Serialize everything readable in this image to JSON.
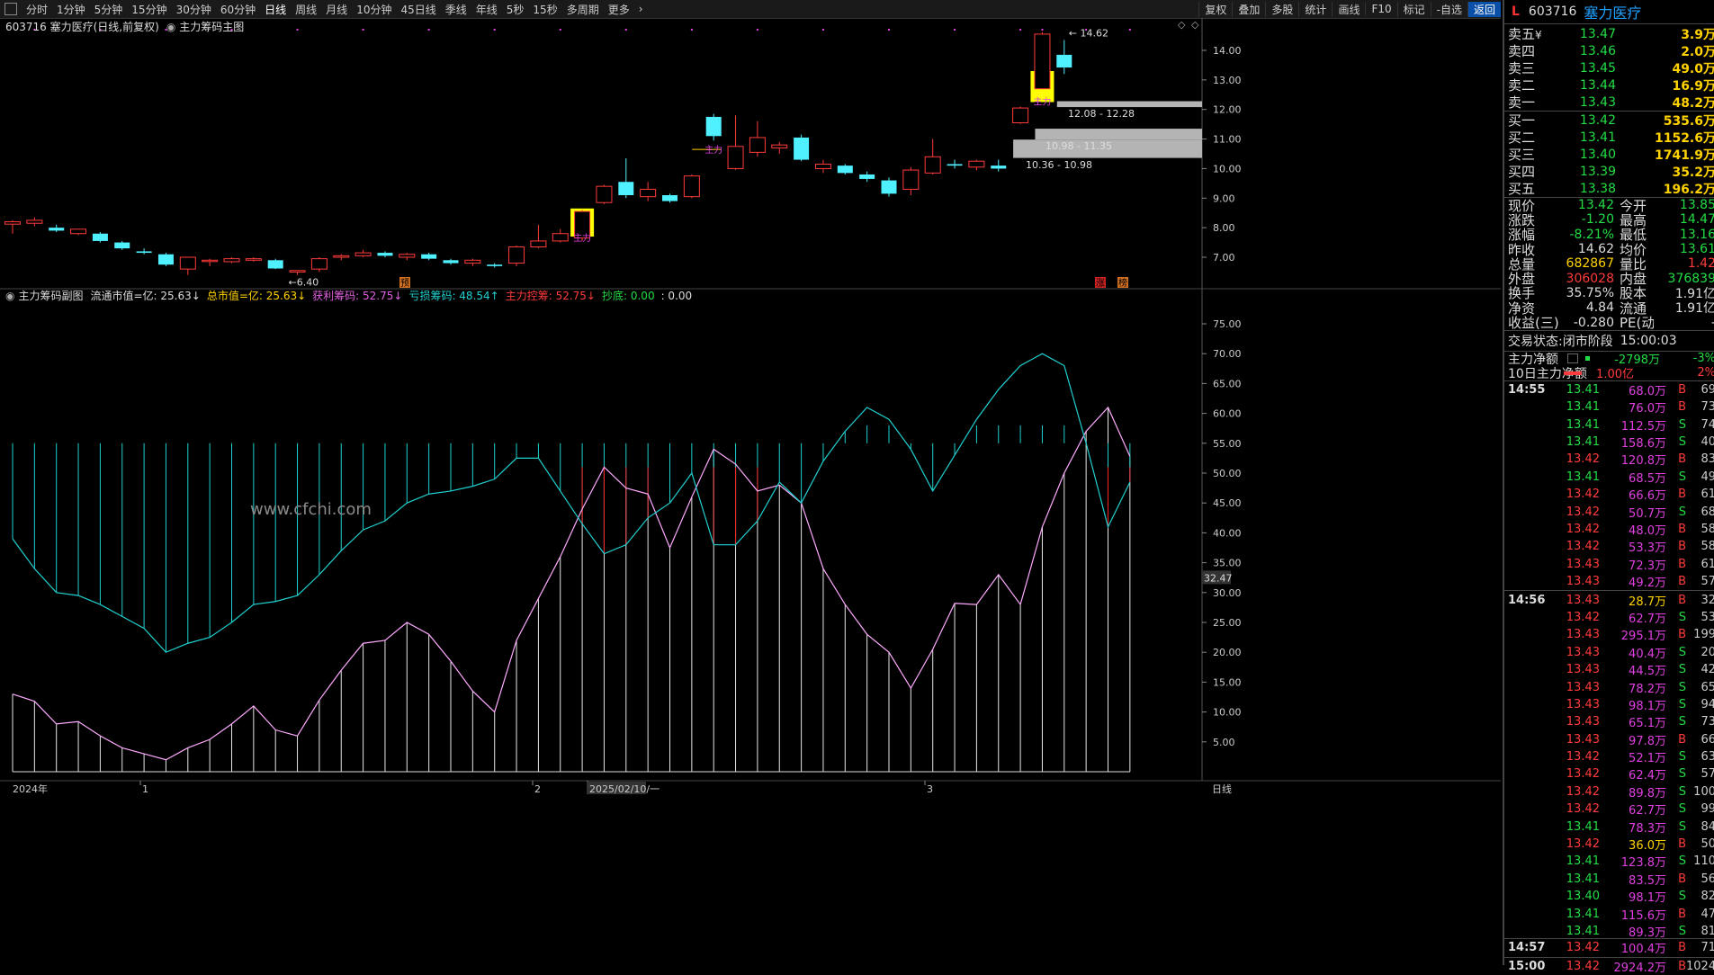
{
  "toolbar": {
    "periods": [
      "分时",
      "1分钟",
      "5分钟",
      "15分钟",
      "30分钟",
      "60分钟",
      "日线",
      "周线",
      "月线",
      "10分钟",
      "45日线",
      "季线",
      "年线",
      "5秒",
      "15秒",
      "多周期",
      "更多"
    ],
    "active_period": "日线",
    "actions": [
      "复权",
      "叠加",
      "多股",
      "统计",
      "画线",
      "F10",
      "标记",
      "-自选",
      "返回"
    ],
    "active_action": "返回"
  },
  "main_chart": {
    "header": "603716 塞力医疗(日线,前复权)",
    "indicator_name": "主力筹码主图",
    "y_ticks": [
      14.0,
      13.0,
      12.0,
      11.0,
      10.0,
      9.0,
      8.0,
      7.0
    ],
    "y_range": [
      6.0,
      15.0
    ],
    "high_label": "14.62",
    "low_label": "6.40",
    "zone_labels": [
      "12.08 - 12.28",
      "10.98 - 11.35",
      "10.36 - 10.98"
    ],
    "zones": [
      {
        "lo": 12.08,
        "hi": 12.28,
        "from": 48
      },
      {
        "lo": 10.98,
        "hi": 11.35,
        "from": 47
      },
      {
        "lo": 10.36,
        "hi": 10.98,
        "from": 46
      }
    ],
    "markers": {
      "main": "主力",
      "pre": "预",
      "rise": "涨",
      "hot": "榜"
    },
    "candles": [
      {
        "o": 8.12,
        "h": 8.25,
        "l": 7.8,
        "c": 8.2
      },
      {
        "o": 8.15,
        "h": 8.35,
        "l": 8.05,
        "c": 8.25
      },
      {
        "o": 8.0,
        "h": 8.1,
        "l": 7.85,
        "c": 7.9
      },
      {
        "o": 7.8,
        "h": 7.95,
        "l": 7.75,
        "c": 7.95
      },
      {
        "o": 7.8,
        "h": 7.85,
        "l": 7.5,
        "c": 7.55
      },
      {
        "o": 7.5,
        "h": 7.55,
        "l": 7.25,
        "c": 7.3
      },
      {
        "o": 7.2,
        "h": 7.3,
        "l": 7.1,
        "c": 7.15
      },
      {
        "o": 7.1,
        "h": 7.15,
        "l": 6.7,
        "c": 6.75
      },
      {
        "o": 6.6,
        "h": 7.0,
        "l": 6.4,
        "c": 7.0
      },
      {
        "o": 6.9,
        "h": 6.95,
        "l": 6.7,
        "c": 6.9
      },
      {
        "o": 6.85,
        "h": 7.0,
        "l": 6.8,
        "c": 6.95
      },
      {
        "o": 6.9,
        "h": 7.0,
        "l": 6.85,
        "c": 6.95
      },
      {
        "o": 6.9,
        "h": 6.95,
        "l": 6.6,
        "c": 6.62
      },
      {
        "o": 6.5,
        "h": 6.55,
        "l": 6.4,
        "c": 6.55
      },
      {
        "o": 6.6,
        "h": 7.0,
        "l": 6.5,
        "c": 6.95
      },
      {
        "o": 7.0,
        "h": 7.1,
        "l": 6.9,
        "c": 7.05
      },
      {
        "o": 7.05,
        "h": 7.25,
        "l": 7.0,
        "c": 7.15
      },
      {
        "o": 7.15,
        "h": 7.2,
        "l": 7.0,
        "c": 7.05
      },
      {
        "o": 7.0,
        "h": 7.15,
        "l": 6.9,
        "c": 7.1
      },
      {
        "o": 7.1,
        "h": 7.15,
        "l": 6.9,
        "c": 6.95
      },
      {
        "o": 6.9,
        "h": 6.95,
        "l": 6.75,
        "c": 6.8
      },
      {
        "o": 6.8,
        "h": 6.95,
        "l": 6.7,
        "c": 6.9
      },
      {
        "o": 6.75,
        "h": 6.8,
        "l": 6.65,
        "c": 6.7
      },
      {
        "o": 6.8,
        "h": 7.4,
        "l": 6.7,
        "c": 7.35
      },
      {
        "o": 7.35,
        "h": 8.1,
        "l": 7.3,
        "c": 7.55
      },
      {
        "o": 7.55,
        "h": 7.95,
        "l": 7.5,
        "c": 7.8
      },
      {
        "o": 7.65,
        "h": 8.6,
        "l": 7.55,
        "c": 8.55
      },
      {
        "o": 8.85,
        "h": 9.45,
        "l": 8.8,
        "c": 9.4
      },
      {
        "o": 9.55,
        "h": 10.35,
        "l": 9.0,
        "c": 9.1
      },
      {
        "o": 9.05,
        "h": 9.55,
        "l": 8.9,
        "c": 9.3
      },
      {
        "o": 9.1,
        "h": 9.15,
        "l": 8.85,
        "c": 8.9
      },
      {
        "o": 9.05,
        "h": 9.8,
        "l": 9.0,
        "c": 9.75
      },
      {
        "o": 11.75,
        "h": 11.85,
        "l": 10.95,
        "c": 11.1
      },
      {
        "o": 10.0,
        "h": 11.8,
        "l": 9.95,
        "c": 10.75
      },
      {
        "o": 10.55,
        "h": 11.6,
        "l": 10.4,
        "c": 11.05
      },
      {
        "o": 10.7,
        "h": 10.9,
        "l": 10.5,
        "c": 10.8
      },
      {
        "o": 11.05,
        "h": 11.15,
        "l": 10.25,
        "c": 10.3
      },
      {
        "o": 10.0,
        "h": 10.3,
        "l": 9.85,
        "c": 10.15
      },
      {
        "o": 10.1,
        "h": 10.15,
        "l": 9.8,
        "c": 9.85
      },
      {
        "o": 9.8,
        "h": 9.9,
        "l": 9.55,
        "c": 9.65
      },
      {
        "o": 9.6,
        "h": 9.7,
        "l": 9.05,
        "c": 9.15
      },
      {
        "o": 9.3,
        "h": 10.05,
        "l": 9.1,
        "c": 9.95
      },
      {
        "o": 9.85,
        "h": 11.0,
        "l": 9.8,
        "c": 10.4
      },
      {
        "o": 10.15,
        "h": 10.3,
        "l": 10.0,
        "c": 10.1
      },
      {
        "o": 10.05,
        "h": 10.3,
        "l": 9.95,
        "c": 10.25
      },
      {
        "o": 10.1,
        "h": 10.3,
        "l": 9.9,
        "c": 10.0
      },
      {
        "o": 11.55,
        "h": 12.1,
        "l": 11.5,
        "c": 12.05
      },
      {
        "o": 12.7,
        "h": 14.62,
        "l": 12.7,
        "c": 14.55
      },
      {
        "o": 13.85,
        "h": 14.35,
        "l": 13.2,
        "c": 13.42
      }
    ],
    "highlight_boxes": [
      {
        "index": 26,
        "lo": 7.7,
        "hi": 8.65
      },
      {
        "index": 47,
        "lo": 12.25,
        "hi": 13.3
      }
    ],
    "main_markers": [
      {
        "index": 32,
        "price": 10.65
      },
      {
        "index": 26,
        "price": 7.67
      },
      {
        "index": 47,
        "price": 12.28
      }
    ]
  },
  "sub_chart": {
    "indicator_name": "主力筹码副图",
    "legend": [
      {
        "text": "流通市值=亿: 25.63↓",
        "color": "#dddddd"
      },
      {
        "text": "总市值=亿: 25.63↓",
        "color": "#ffd200"
      },
      {
        "text": "获利筹码: 52.75↓",
        "color": "#e060e0"
      },
      {
        "text": "亏损筹码: 48.54↑",
        "color": "#20d0d0"
      },
      {
        "text": "主力控筹: 52.75↓",
        "color": "#ff3b3b"
      },
      {
        "text": "抄底: 0.00",
        "color": "#22dd44"
      },
      {
        "text": ": 0.00",
        "color": "#dddddd"
      }
    ],
    "y_ticks": [
      75,
      70,
      65,
      60,
      55,
      50,
      45,
      40,
      35,
      30,
      25,
      20,
      15,
      10,
      5
    ],
    "y_range": [
      0,
      80
    ],
    "current_label": "32.47",
    "watermark": "www.cfchi.com",
    "profit": [
      13,
      11.8,
      8,
      8.4,
      6,
      4,
      3,
      2,
      4,
      5.4,
      8,
      11,
      7,
      6,
      12,
      17,
      21.5,
      22,
      25,
      23,
      18.5,
      13.5,
      10,
      22,
      29,
      36,
      44,
      51,
      47.5,
      46.5,
      37.5,
      46,
      54,
      51.5,
      47,
      48,
      45,
      34,
      28,
      23,
      20,
      14,
      20.5,
      28.2,
      28,
      33,
      28,
      41,
      50,
      57,
      61,
      52.8
    ],
    "loss": [
      39,
      34,
      30,
      29.5,
      28,
      26,
      24,
      20,
      21.5,
      22.5,
      25,
      28,
      28.5,
      29.5,
      33,
      37,
      40.5,
      42,
      45,
      46.5,
      47,
      47.8,
      49,
      52.5,
      52.5,
      47,
      41.5,
      36.5,
      38,
      42.5,
      45,
      50,
      38,
      38,
      42,
      48.5,
      45,
      52,
      57,
      61,
      59,
      54,
      47,
      53,
      59,
      64,
      68,
      70,
      68,
      55,
      41,
      48.5
    ]
  },
  "x_axis": {
    "labels": [
      "2024年",
      "1",
      "2",
      "2025/02/10/一",
      "3",
      "日线"
    ]
  },
  "quote": {
    "code": "603716",
    "name": "塞力医疗",
    "L": "L",
    "asks": [
      {
        "label": "卖五",
        "price": "13.47",
        "vol": "3.9万"
      },
      {
        "label": "卖四",
        "price": "13.46",
        "vol": "2.0万"
      },
      {
        "label": "卖三",
        "price": "13.45",
        "vol": "49.0万"
      },
      {
        "label": "卖二",
        "price": "13.44",
        "vol": "16.9万"
      },
      {
        "label": "卖一",
        "price": "13.43",
        "vol": "48.2万"
      }
    ],
    "ask5_symbol": "¥",
    "bids": [
      {
        "label": "买一",
        "price": "13.42",
        "vol": "535.6万"
      },
      {
        "label": "买二",
        "price": "13.41",
        "vol": "1152.6万"
      },
      {
        "label": "买三",
        "price": "13.40",
        "vol": "1741.9万"
      },
      {
        "label": "买四",
        "price": "13.39",
        "vol": "35.2万"
      },
      {
        "label": "买五",
        "price": "13.38",
        "vol": "196.2万"
      }
    ],
    "stats": [
      {
        "l1": "现价",
        "v1": "13.42",
        "c1": "green",
        "l2": "今开",
        "v2": "13.85",
        "c2": "green"
      },
      {
        "l1": "涨跌",
        "v1": "-1.20",
        "c1": "green",
        "l2": "最高",
        "v2": "14.47",
        "c2": "green"
      },
      {
        "l1": "涨幅",
        "v1": "-8.21%",
        "c1": "green",
        "l2": "最低",
        "v2": "13.16",
        "c2": "green"
      },
      {
        "l1": "昨收",
        "v1": "14.62",
        "c1": "white",
        "l2": "均价",
        "v2": "13.61",
        "c2": "green"
      },
      {
        "l1": "总量",
        "v1": "682867",
        "c1": "yellow",
        "l2": "量比",
        "v2": "1.42",
        "c2": "red"
      },
      {
        "l1": "外盘",
        "v1": "306028",
        "c1": "red",
        "l2": "内盘",
        "v2": "376839",
        "c2": "green"
      },
      {
        "l1": "换手",
        "v1": "35.75%",
        "c1": "white",
        "l2": "股本",
        "v2": "1.91亿",
        "c2": "white"
      },
      {
        "l1": "净资",
        "v1": "4.84",
        "c1": "white",
        "l2": "流通",
        "v2": "1.91亿",
        "c2": "white"
      },
      {
        "l1": "收益(三)",
        "v1": "-0.280",
        "c1": "white",
        "l2": "PE(动)",
        "v2": "-",
        "c2": "white"
      }
    ],
    "trade_status_label": "交易状态:",
    "trade_status": "闭市阶段",
    "trade_time": "15:00:03",
    "flow": [
      {
        "label": "主力净额",
        "value": "-2798万",
        "pct": "-3%",
        "vcolor": "green",
        "pcolor": "green"
      },
      {
        "label": "10日主力净额",
        "value": "1.00亿",
        "pct": "2%",
        "vcolor": "red",
        "pcolor": "red"
      }
    ],
    "ticks": [
      {
        "t": "14:55",
        "p": "13.41",
        "v": "68.0万",
        "s": "B",
        "n": "69"
      },
      {
        "t": "",
        "p": "13.41",
        "v": "76.0万",
        "s": "B",
        "n": "73"
      },
      {
        "t": "",
        "p": "13.41",
        "v": "112.5万",
        "s": "S",
        "n": "74"
      },
      {
        "t": "",
        "p": "13.41",
        "v": "158.6万",
        "s": "S",
        "n": "40"
      },
      {
        "t": "",
        "p": "13.42",
        "v": "120.8万",
        "s": "B",
        "n": "83"
      },
      {
        "t": "",
        "p": "13.41",
        "v": "68.5万",
        "s": "S",
        "n": "49"
      },
      {
        "t": "",
        "p": "13.42",
        "v": "66.6万",
        "s": "B",
        "n": "61"
      },
      {
        "t": "",
        "p": "13.42",
        "v": "50.7万",
        "s": "S",
        "n": "68"
      },
      {
        "t": "",
        "p": "13.42",
        "v": "48.0万",
        "s": "B",
        "n": "58"
      },
      {
        "t": "",
        "p": "13.42",
        "v": "53.3万",
        "s": "B",
        "n": "58"
      },
      {
        "t": "",
        "p": "13.43",
        "v": "72.3万",
        "s": "B",
        "n": "61"
      },
      {
        "t": "",
        "p": "13.43",
        "v": "49.2万",
        "s": "B",
        "n": "57"
      },
      {
        "t": "14:56",
        "p": "13.43",
        "v": "28.7万",
        "s": "B",
        "n": "32"
      },
      {
        "t": "",
        "p": "13.42",
        "v": "62.7万",
        "s": "S",
        "n": "53"
      },
      {
        "t": "",
        "p": "13.43",
        "v": "295.1万",
        "s": "B",
        "n": "199"
      },
      {
        "t": "",
        "p": "13.43",
        "v": "40.4万",
        "s": "S",
        "n": "20"
      },
      {
        "t": "",
        "p": "13.43",
        "v": "44.5万",
        "s": "S",
        "n": "42"
      },
      {
        "t": "",
        "p": "13.43",
        "v": "78.2万",
        "s": "S",
        "n": "65"
      },
      {
        "t": "",
        "p": "13.43",
        "v": "98.1万",
        "s": "S",
        "n": "94"
      },
      {
        "t": "",
        "p": "13.43",
        "v": "65.1万",
        "s": "S",
        "n": "73"
      },
      {
        "t": "",
        "p": "13.43",
        "v": "97.8万",
        "s": "B",
        "n": "66"
      },
      {
        "t": "",
        "p": "13.42",
        "v": "52.1万",
        "s": "S",
        "n": "63"
      },
      {
        "t": "",
        "p": "13.42",
        "v": "62.4万",
        "s": "S",
        "n": "57"
      },
      {
        "t": "",
        "p": "13.42",
        "v": "89.8万",
        "s": "S",
        "n": "100"
      },
      {
        "t": "",
        "p": "13.42",
        "v": "62.7万",
        "s": "S",
        "n": "99"
      },
      {
        "t": "",
        "p": "13.41",
        "v": "78.3万",
        "s": "S",
        "n": "84"
      },
      {
        "t": "",
        "p": "13.42",
        "v": "36.0万",
        "s": "B",
        "n": "50"
      },
      {
        "t": "",
        "p": "13.41",
        "v": "123.8万",
        "s": "S",
        "n": "110"
      },
      {
        "t": "",
        "p": "13.41",
        "v": "83.5万",
        "s": "B",
        "n": "56"
      },
      {
        "t": "",
        "p": "13.40",
        "v": "98.1万",
        "s": "S",
        "n": "82"
      },
      {
        "t": "",
        "p": "13.41",
        "v": "115.6万",
        "s": "B",
        "n": "47"
      },
      {
        "t": "",
        "p": "13.41",
        "v": "89.3万",
        "s": "S",
        "n": "81"
      },
      {
        "t": "14:57",
        "p": "13.42",
        "v": "100.4万",
        "s": "B",
        "n": "71"
      },
      {
        "t": "15:00",
        "p": "13.42",
        "v": "2924.2万",
        "s": "B",
        "n": "1024"
      }
    ]
  },
  "colors": {
    "up": "#ff3b3b",
    "down": "#4ff0ff",
    "bg": "#000000",
    "grid": "#333333",
    "profit": "#ffaaff",
    "loss": "#20d0d0",
    "zone": "#b4b4b4",
    "highlight": "#ffff00"
  }
}
